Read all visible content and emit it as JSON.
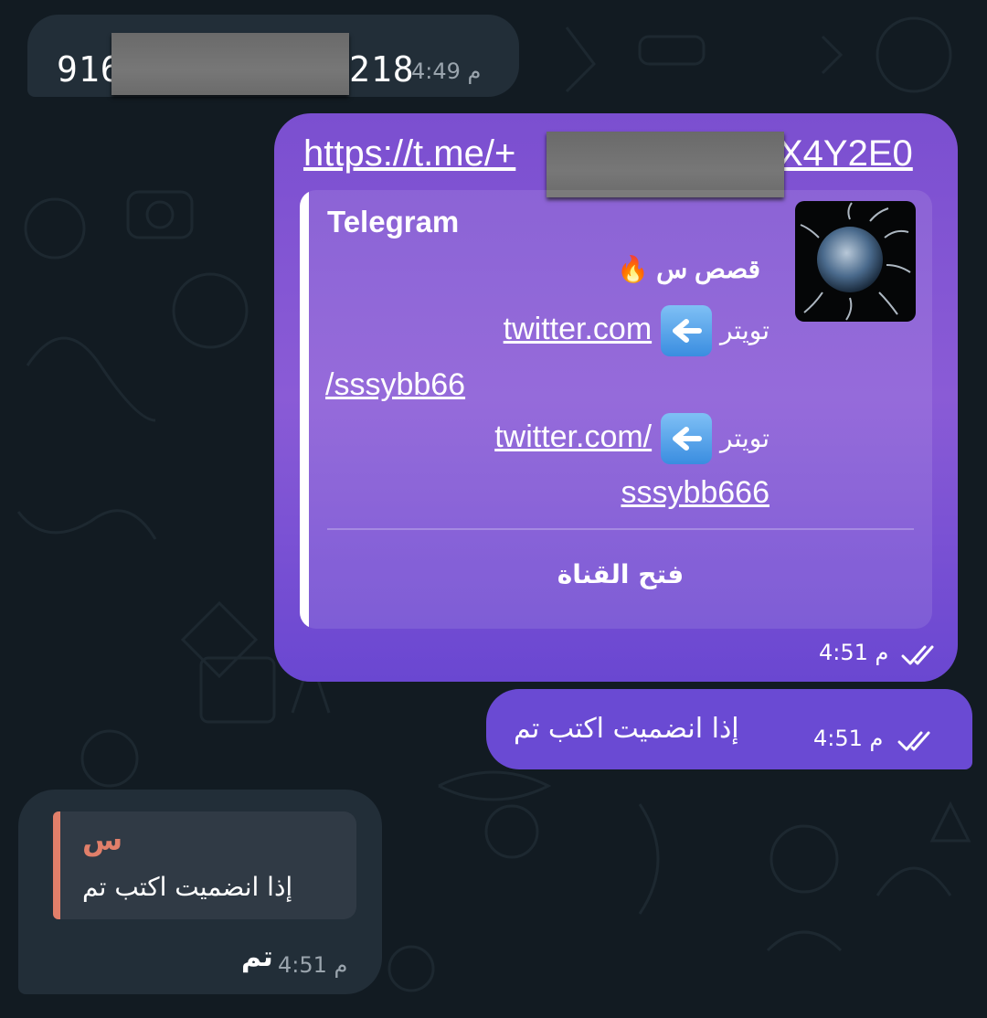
{
  "messages": {
    "in_1": {
      "text_prefix": "916",
      "text_suffix": "218",
      "time": "4:49 م"
    },
    "out_1": {
      "link_prefix": "https://t.me/+",
      "link_suffix": "X4Y2E0",
      "preview": {
        "site": "Telegram",
        "title": "قصص س 🔥",
        "line1_label": "تويتر",
        "line1_link": "twitter.com",
        "line2_link": "/sssybb66",
        "line3_label": "تويتر",
        "line3_link": "twitter.com/",
        "line4_link": "sssybb666",
        "button": "فتح القناة"
      },
      "time": "4:51 م",
      "status": "read"
    },
    "out_2": {
      "text": "إذا انضميت اكتب تم",
      "time": "4:51 م",
      "status": "read"
    },
    "in_2": {
      "reply_author": "س",
      "reply_text": "إذا انضميت اكتب تم",
      "text": "تم",
      "time": "4:51 م"
    }
  },
  "colors": {
    "background": "#121b22",
    "incoming_bubble": "#222e38",
    "outgoing_bubble": "#7b4fd0",
    "reply_accent": "#e17f6a"
  },
  "icons": {
    "read_status": "double-check-icon",
    "preview_arrow": "left-arrow-emoji-icon",
    "title_fire": "fire-emoji-icon"
  }
}
